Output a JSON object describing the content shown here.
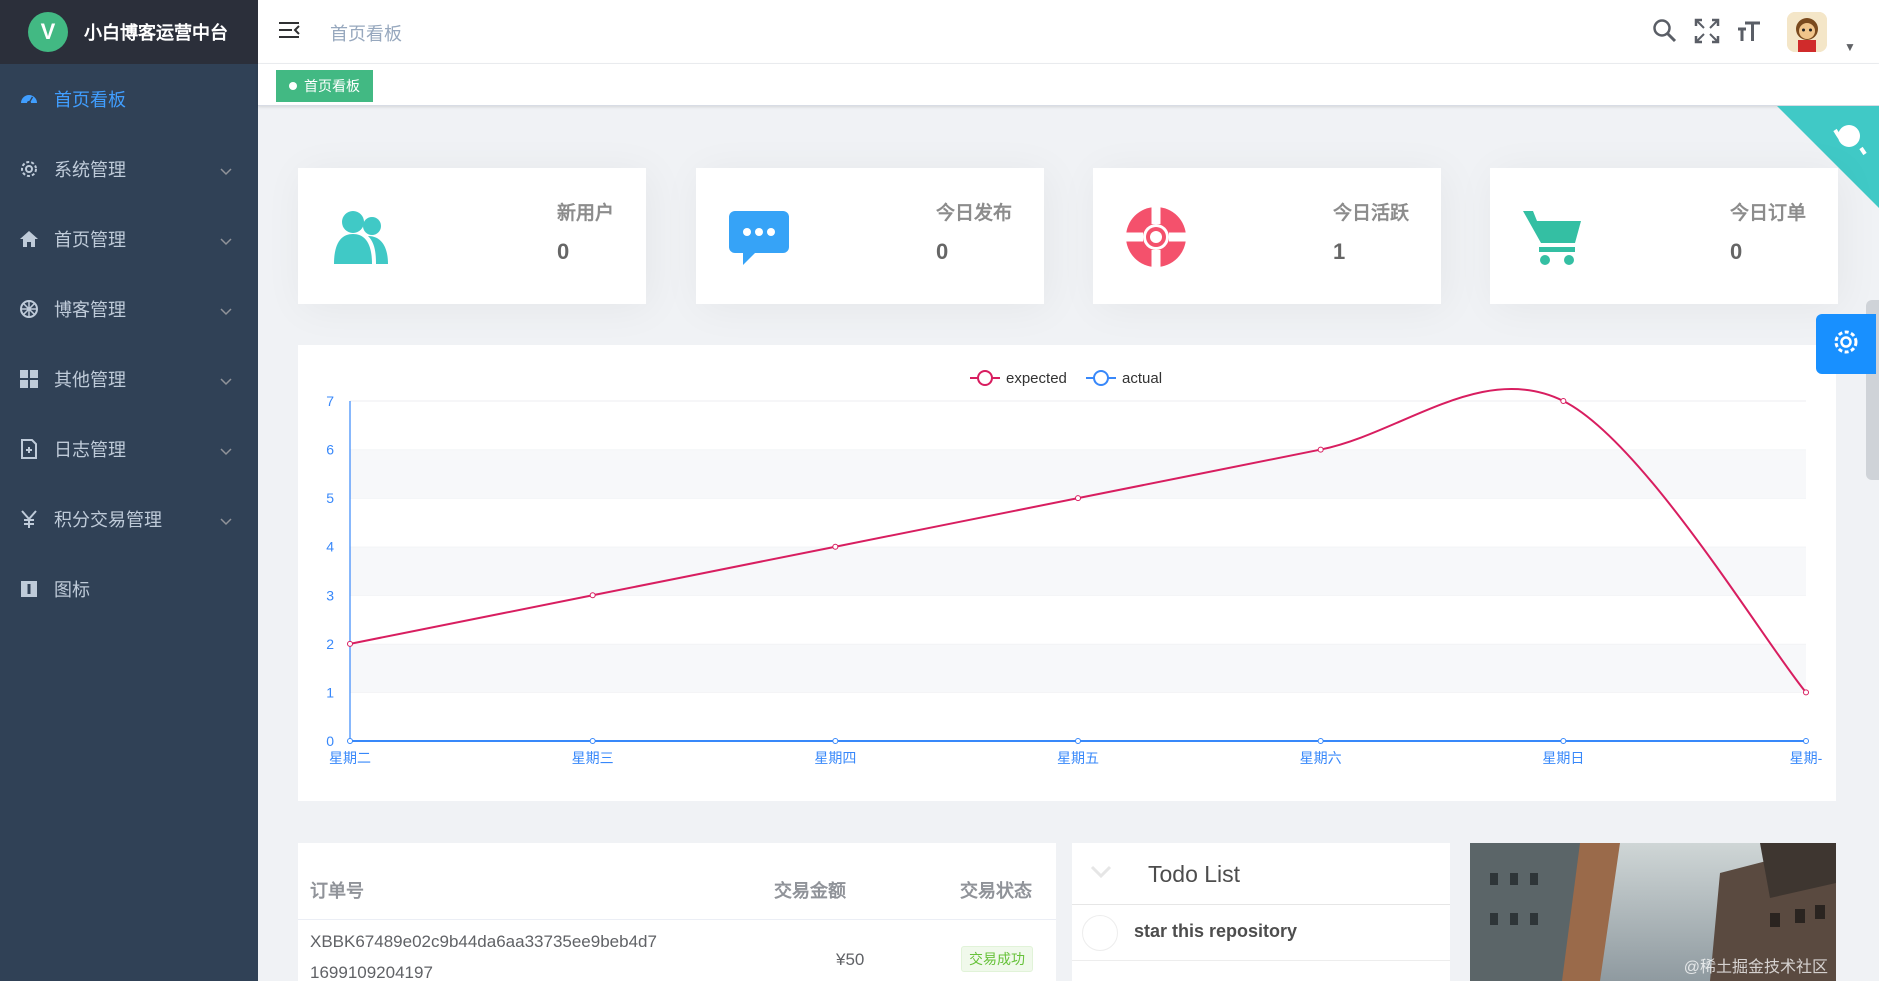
{
  "app": {
    "logo_letter": "V",
    "title": "小白博客运营中台"
  },
  "sidebar": {
    "items": [
      {
        "label": "首页看板",
        "icon": "dashboard-icon",
        "active": true
      },
      {
        "label": "系统管理",
        "icon": "gear-icon"
      },
      {
        "label": "首页管理",
        "icon": "home-icon"
      },
      {
        "label": "博客管理",
        "icon": "wheel-icon"
      },
      {
        "label": "其他管理",
        "icon": "grid-icon"
      },
      {
        "label": "日志管理",
        "icon": "log-file-icon"
      },
      {
        "label": "积分交易管理",
        "icon": "yen-icon"
      },
      {
        "label": "图标",
        "icon": "icon-icon"
      }
    ]
  },
  "navbar": {
    "breadcrumb": "首页看板"
  },
  "tags": {
    "active": "首页看板"
  },
  "stats": [
    {
      "label": "新用户",
      "value": "0",
      "icon": "peoples-icon",
      "color": "#40c9c6"
    },
    {
      "label": "今日发布",
      "value": "0",
      "icon": "message-icon",
      "color": "#36a3f7"
    },
    {
      "label": "今日活跃",
      "value": "1",
      "icon": "lifebuoy-icon",
      "color": "#f4516c"
    },
    {
      "label": "今日订单",
      "value": "0",
      "icon": "shopping-cart-icon",
      "color": "#34bfa3"
    }
  ],
  "chart_data": {
    "type": "line",
    "categories": [
      "星期二",
      "星期三",
      "星期四",
      "星期五",
      "星期六",
      "星期日",
      "星期-"
    ],
    "series": [
      {
        "name": "expected",
        "values": [
          2,
          3,
          4,
          5,
          6,
          7,
          1
        ],
        "color": "#d81e60"
      },
      {
        "name": "actual",
        "values": [
          0,
          0,
          0,
          0,
          0,
          0,
          0
        ],
        "color": "#3888fa"
      }
    ],
    "yticks": [
      "0",
      "1",
      "2",
      "3",
      "4",
      "5",
      "6",
      "7"
    ],
    "ylim": [
      0,
      7
    ],
    "legend": "top-center",
    "grid": true
  },
  "orders": {
    "headers": [
      "订单号",
      "交易金额",
      "交易状态"
    ],
    "rows": [
      {
        "order_no_line1": "XBBK67489e02c9b44da6aa33735ee9beb4d7",
        "order_no_line2": "1699109204197",
        "amount": "¥50",
        "status": "交易成功"
      }
    ]
  },
  "todo": {
    "title": "Todo List",
    "items": [
      "star this repository"
    ]
  },
  "photo": {
    "watermark": "@稀土掘金技术社区"
  }
}
